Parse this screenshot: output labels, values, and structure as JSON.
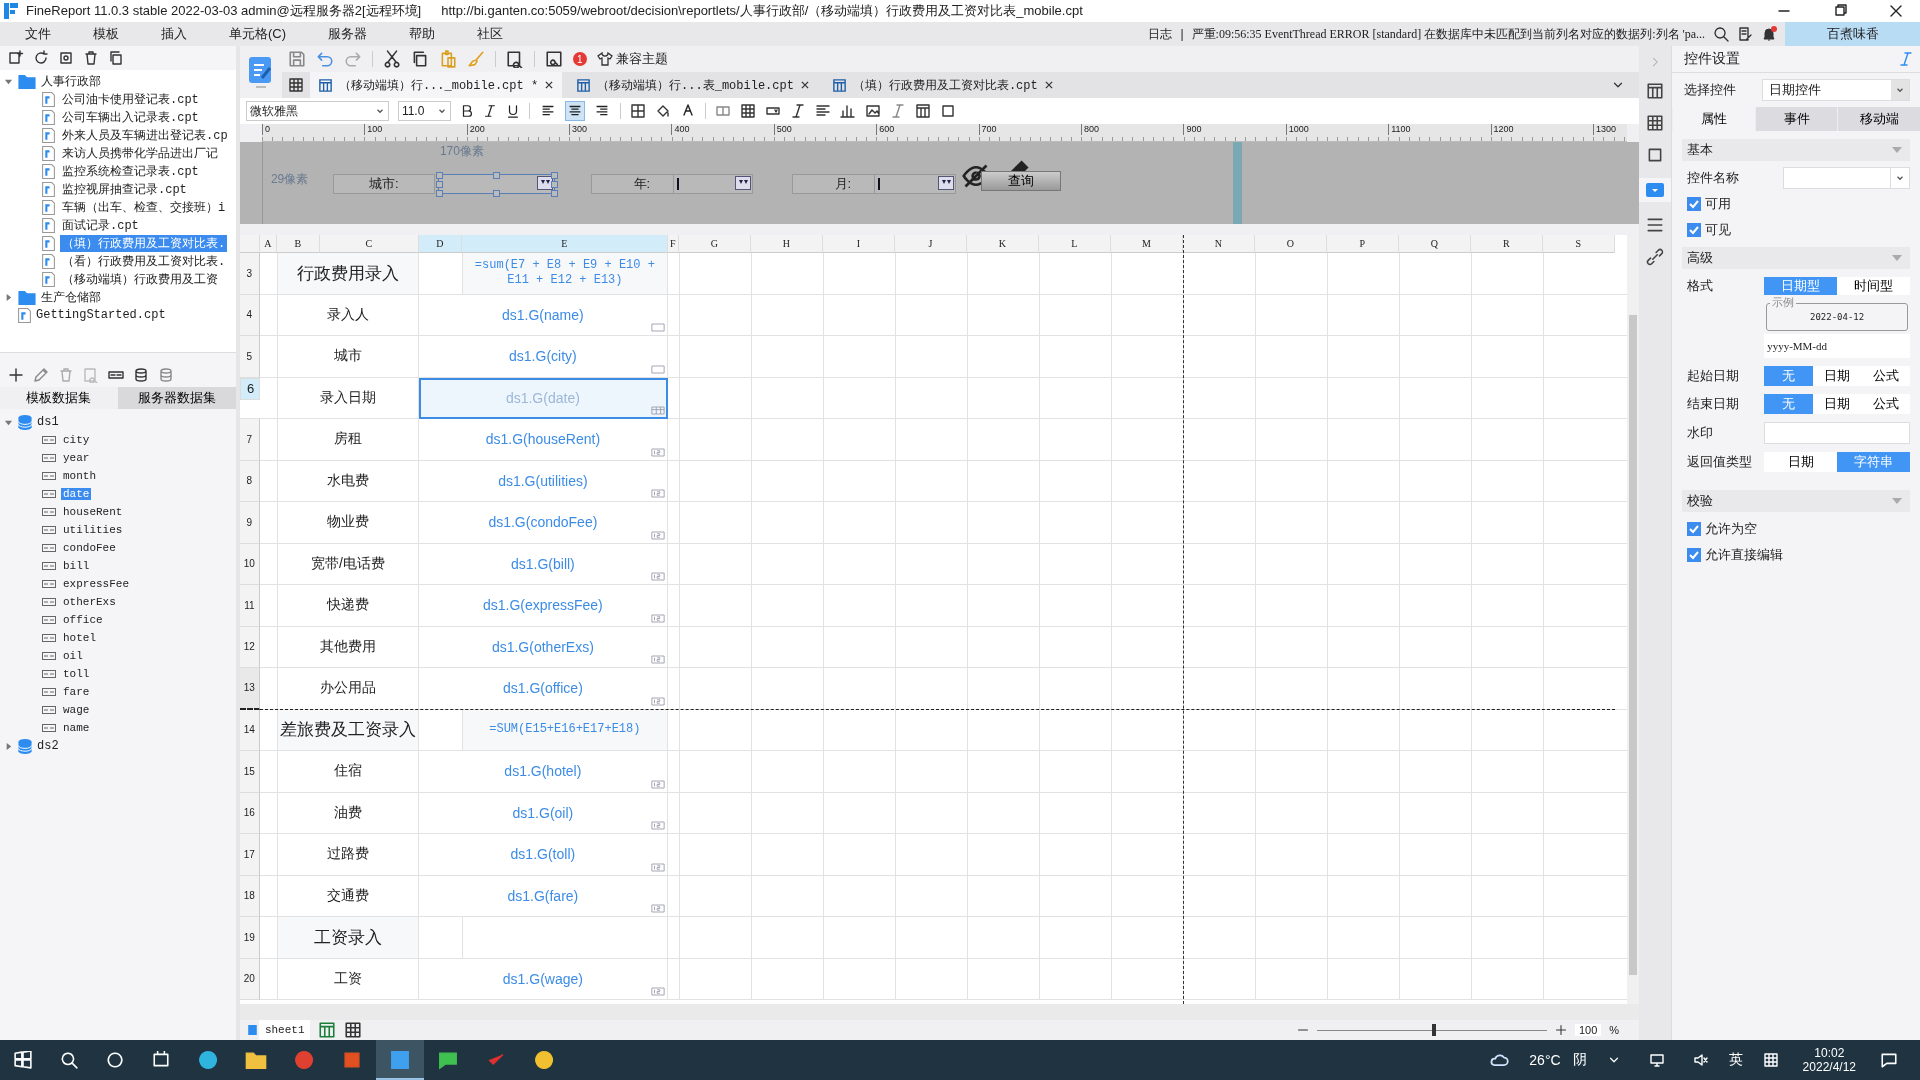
{
  "title_bar": {
    "app": "FineReport 11.0.3 stable 2022-03-03 admin@远程服务器2[远程环境]",
    "path": "http://bi.ganten.co:5059/webroot/decision\\reportlets/人事行政部/（移动端填）行政费用及工资对比表_mobile.cpt"
  },
  "menu": [
    "文件",
    "模板",
    "插入",
    "单元格(C)",
    "服务器",
    "帮助",
    "社区"
  ],
  "log_bar": {
    "label": "日志",
    "separator": "|",
    "message": "严重:09:56:35 EventThread ERROR [standard] 在数据库中未匹配到当前列名对应的数据列:列名 'pa...",
    "user": "百煮味香"
  },
  "template_tree": [
    {
      "label": "人事行政部",
      "kind": "folder",
      "expanded": true,
      "children": [
        {
          "label": "公司油卡使用登记表.cpt",
          "selected": false
        },
        {
          "label": "公司车辆出入记录表.cpt",
          "selected": false
        },
        {
          "label": "外来人员及车辆进出登记表.cp",
          "selected": false
        },
        {
          "label": "来访人员携带化学品进出厂记",
          "selected": false
        },
        {
          "label": "监控系统检查记录表.cpt",
          "selected": false
        },
        {
          "label": "监控视屏抽查记录.cpt",
          "selected": false
        },
        {
          "label": "车辆（出车、检查、交接班）i",
          "selected": false
        },
        {
          "label": "面试记录.cpt",
          "selected": false
        },
        {
          "label": "（填）行政费用及工资对比表.",
          "selected": true
        },
        {
          "label": "（看）行政费用及工资对比表.",
          "selected": false
        },
        {
          "label": "（移动端填）行政费用及工资",
          "selected": false
        }
      ]
    },
    {
      "label": "生产仓储部",
      "kind": "folder",
      "expanded": false
    },
    {
      "label": "GettingStarted.cpt",
      "kind": "file"
    }
  ],
  "dataset_tabs": [
    {
      "label": "模板数据集",
      "selected": true
    },
    {
      "label": "服务器数据集",
      "selected": false
    }
  ],
  "datasets": [
    {
      "name": "ds1",
      "expanded": true,
      "fields": [
        {
          "name": "city",
          "selected": false
        },
        {
          "name": "year",
          "selected": false
        },
        {
          "name": "month",
          "selected": false
        },
        {
          "name": "date",
          "selected": true
        },
        {
          "name": "houseRent",
          "selected": false
        },
        {
          "name": "utilities",
          "selected": false
        },
        {
          "name": "condoFee",
          "selected": false
        },
        {
          "name": "bill",
          "selected": false
        },
        {
          "name": "expressFee",
          "selected": false
        },
        {
          "name": "otherExs",
          "selected": false
        },
        {
          "name": "office",
          "selected": false
        },
        {
          "name": "hotel",
          "selected": false
        },
        {
          "name": "oil",
          "selected": false
        },
        {
          "name": "toll",
          "selected": false
        },
        {
          "name": "fare",
          "selected": false
        },
        {
          "name": "wage",
          "selected": false
        },
        {
          "name": "name",
          "selected": false
        }
      ]
    },
    {
      "name": "ds2",
      "expanded": false
    }
  ],
  "editor_toolbar": {
    "badge": "1",
    "theme_button": "兼容主题"
  },
  "tabs": [
    {
      "label": "（移动端填）行..._mobile.cpt *",
      "selected": true
    },
    {
      "label": "（移动端填）行...表_mobile.cpt",
      "selected": false
    },
    {
      "label": "（填）行政费用及工资对比表.cpt",
      "selected": false
    }
  ],
  "format_bar": {
    "font": "微软雅黑",
    "size": "11.0",
    "alignments": [
      {
        "kind": "left",
        "selected": false
      },
      {
        "kind": "center",
        "selected": true
      },
      {
        "kind": "right",
        "selected": false
      }
    ]
  },
  "ruler": [
    "0",
    "100",
    "200",
    "300",
    "400",
    "500",
    "600",
    "700",
    "800",
    "900",
    "1000",
    "1100",
    "1200",
    "1300"
  ],
  "parameter_panel": {
    "width_hint": "170像素",
    "height_hint": "29像素",
    "fields": [
      {
        "label": "城市:",
        "selected": true
      },
      {
        "label": "年:",
        "selected": false
      },
      {
        "label": "月:",
        "selected": false
      }
    ],
    "button": "查询"
  },
  "columns": [
    {
      "label": "A",
      "selected": false
    },
    {
      "label": "B",
      "selected": false
    },
    {
      "label": "C",
      "selected": false
    },
    {
      "label": "D",
      "selected": true
    },
    {
      "label": "E",
      "selected": true
    },
    {
      "label": "F",
      "selected": false
    },
    {
      "label": "G",
      "selected": false
    },
    {
      "label": "H",
      "selected": false
    },
    {
      "label": "I",
      "selected": false
    },
    {
      "label": "J",
      "selected": false
    },
    {
      "label": "K",
      "selected": false
    },
    {
      "label": "L",
      "selected": false
    },
    {
      "label": "M",
      "selected": false
    },
    {
      "label": "N",
      "selected": false
    },
    {
      "label": "O",
      "selected": false
    },
    {
      "label": "P",
      "selected": false
    },
    {
      "label": "Q",
      "selected": false
    },
    {
      "label": "R",
      "selected": false
    },
    {
      "label": "S",
      "selected": false
    }
  ],
  "rows": [
    {
      "num": "3",
      "label": "行政费用录入",
      "kind": "formula_section",
      "value": "=sum(E7 + E8 + E9 + E10 + E11 + E12 + E13)",
      "selected": false,
      "page_break": false
    },
    {
      "num": "4",
      "label": "录入人",
      "kind": "text_field",
      "value": "ds1.G(name)",
      "selected": false,
      "page_break": false
    },
    {
      "num": "5",
      "label": "城市",
      "kind": "text_field",
      "value": "ds1.G(city)",
      "selected": false,
      "page_break": false
    },
    {
      "num": "6",
      "label": "录入日期",
      "kind": "date_field",
      "value": "ds1.G(date)",
      "selected": true,
      "page_break": false
    },
    {
      "num": "7",
      "label": "房租",
      "kind": "number_field",
      "value": "ds1.G(houseRent)",
      "selected": false,
      "page_break": false
    },
    {
      "num": "8",
      "label": "水电费",
      "kind": "number_field",
      "value": "ds1.G(utilities)",
      "selected": false,
      "page_break": false
    },
    {
      "num": "9",
      "label": "物业费",
      "kind": "number_field",
      "value": "ds1.G(condoFee)",
      "selected": false,
      "page_break": false
    },
    {
      "num": "10",
      "label": "宽带/电话费",
      "kind": "number_field",
      "value": "ds1.G(bill)",
      "selected": false,
      "page_break": false
    },
    {
      "num": "11",
      "label": "快递费",
      "kind": "number_field",
      "value": "ds1.G(expressFee)",
      "selected": false,
      "page_break": false
    },
    {
      "num": "12",
      "label": "其他费用",
      "kind": "number_field",
      "value": "ds1.G(otherExs)",
      "selected": false,
      "page_break": false
    },
    {
      "num": "13",
      "label": "办公用品",
      "kind": "number_field",
      "value": "ds1.G(office)",
      "selected": false,
      "page_break": true
    },
    {
      "num": "14",
      "label": "差旅费及工资录入",
      "kind": "formula_section",
      "value": "=SUM(E15+E16+E17+E18)",
      "selected": false,
      "page_break": false
    },
    {
      "num": "15",
      "label": "住宿",
      "kind": "number_field",
      "value": "ds1.G(hotel)",
      "selected": false,
      "page_break": false
    },
    {
      "num": "16",
      "label": "油费",
      "kind": "number_field",
      "value": "ds1.G(oil)",
      "selected": false,
      "page_break": false
    },
    {
      "num": "17",
      "label": "过路费",
      "kind": "number_field",
      "value": "ds1.G(toll)",
      "selected": false,
      "page_break": false
    },
    {
      "num": "18",
      "label": "交通费",
      "kind": "number_field",
      "value": "ds1.G(fare)",
      "selected": false,
      "page_break": false
    },
    {
      "num": "19",
      "label": "工资录入",
      "kind": "empty_section",
      "selected": false,
      "page_break": false
    },
    {
      "num": "20",
      "label": "工资",
      "kind": "number_field",
      "value": "ds1.G(wage)",
      "selected": false,
      "page_break": false
    }
  ],
  "status_bar": {
    "sheet": "sheet1",
    "zoom_slider": {
      "level": 0.51
    },
    "zoom": "100",
    "percent": "%"
  },
  "widget_settings": {
    "title": "控件设置",
    "select_label": "选择控件",
    "select_value": "日期控件",
    "tabs": [
      {
        "label": "属性",
        "selected": true
      },
      {
        "label": "事件",
        "selected": false
      },
      {
        "label": "移动端",
        "selected": false
      }
    ],
    "basic": {
      "title": "基本",
      "name_label": "控件名称",
      "checks": [
        {
          "label": "可用",
          "checked": true
        },
        {
          "label": "可见",
          "checked": true
        }
      ]
    },
    "advanced": {
      "title": "高级",
      "format_label": "格式",
      "format_options": [
        {
          "label": "日期型",
          "selected": true
        },
        {
          "label": "时间型",
          "selected": false
        }
      ],
      "example_legend": "示例",
      "example_value": "2022-04-12",
      "format_value": "yyyy-MM-dd",
      "start_label": "起始日期",
      "start_options": [
        {
          "label": "无",
          "selected": true
        },
        {
          "label": "日期",
          "selected": false
        },
        {
          "label": "公式",
          "selected": false
        }
      ],
      "end_label": "结束日期",
      "end_options": [
        {
          "label": "无",
          "selected": true
        },
        {
          "label": "日期",
          "selected": false
        },
        {
          "label": "公式",
          "selected": false
        }
      ],
      "watermark_label": "水印",
      "return_label": "返回值类型",
      "return_options": [
        {
          "label": "日期",
          "selected": false
        },
        {
          "label": "字符串",
          "selected": true
        }
      ]
    },
    "validation": {
      "title": "校验",
      "checks": [
        {
          "label": "允许为空",
          "checked": true
        },
        {
          "label": "允许直接编辑",
          "checked": true
        }
      ]
    }
  },
  "taskbar": {
    "apps": [
      {
        "kind": "edge",
        "selected": false
      },
      {
        "kind": "folder",
        "selected": false
      },
      {
        "kind": "chrome",
        "selected": false
      },
      {
        "kind": "office",
        "selected": false
      },
      {
        "kind": "finereport",
        "selected": true
      },
      {
        "kind": "wechat",
        "selected": false
      },
      {
        "kind": "red",
        "selected": false
      },
      {
        "kind": "yellow",
        "selected": false
      }
    ],
    "weather": "26°C",
    "condition": "阴",
    "ime": "英",
    "time": "10:02",
    "date": "2022/4/12"
  }
}
